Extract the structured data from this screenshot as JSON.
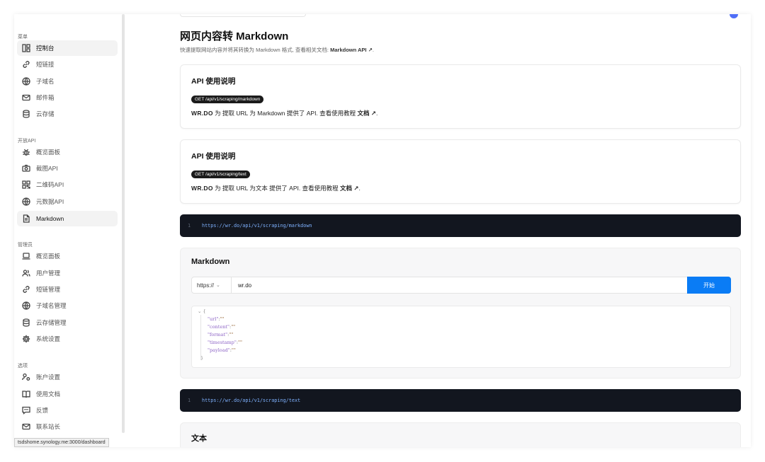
{
  "sidebar": {
    "sections": [
      {
        "title": "菜单",
        "items": [
          {
            "label": "控制台",
            "icon": "dashboard-icon",
            "active": true
          },
          {
            "label": "短链接",
            "icon": "link-icon"
          },
          {
            "label": "子域名",
            "icon": "globe-icon"
          },
          {
            "label": "邮件箱",
            "icon": "mail-icon"
          },
          {
            "label": "云存储",
            "icon": "database-icon"
          }
        ]
      },
      {
        "title": "开放API",
        "items": [
          {
            "label": "概览面板",
            "icon": "bug-icon"
          },
          {
            "label": "截图API",
            "icon": "camera-icon"
          },
          {
            "label": "二维码API",
            "icon": "qrcode-icon"
          },
          {
            "label": "元数据API",
            "icon": "globe-icon"
          },
          {
            "label": "Markdown",
            "icon": "file-text-icon",
            "active": true
          }
        ]
      },
      {
        "title": "管理员",
        "items": [
          {
            "label": "概览面板",
            "icon": "laptop-icon"
          },
          {
            "label": "用户管理",
            "icon": "users-icon"
          },
          {
            "label": "短链管理",
            "icon": "link-icon"
          },
          {
            "label": "子域名管理",
            "icon": "globe-icon"
          },
          {
            "label": "云存储管理",
            "icon": "database-icon"
          },
          {
            "label": "系统设置",
            "icon": "gear-icon"
          }
        ]
      },
      {
        "title": "选项",
        "items": [
          {
            "label": "账户设置",
            "icon": "user-cog-icon"
          },
          {
            "label": "使用文档",
            "icon": "book-icon"
          },
          {
            "label": "反馈",
            "icon": "message-icon"
          },
          {
            "label": "联系站长",
            "icon": "mail-icon"
          }
        ]
      }
    ]
  },
  "status_url": "tsdshome.synology.me:3000/dashboard",
  "page": {
    "title": "网页内容转 Markdown",
    "subtitle_prefix": "快速提取网站内容并将其转换为 Markdown 格式, 查看相关文档:",
    "subtitle_link": "Markdown API ↗",
    "subtitle_suffix": "."
  },
  "cards": [
    {
      "title": "API 使用说明",
      "endpoint": "GET /api/v1/scraping/markdown",
      "brand": "WR.DO",
      "line_prefix": "为 提取 URL 为 Markdown 提供了 API. 查看使用教程",
      "link": "文档 ↗",
      "line_suffix": "."
    },
    {
      "title": "API 使用说明",
      "endpoint": "GET /api/v1/scraping/text",
      "brand": "WR.DO",
      "line_prefix": "为 提取 URL 为文本 提供了 API. 查看使用教程",
      "link": "文档 ↗",
      "line_suffix": "."
    }
  ],
  "code_blocks": [
    {
      "line_no": "1",
      "url": "https://wr.do/api/v1/scraping/markdown"
    },
    {
      "line_no": "1",
      "url": "https://wr.do/api/v1/scraping/text"
    }
  ],
  "markdown_panel": {
    "title": "Markdown",
    "protocol": "https://",
    "domain": "wr.do",
    "start_label": "开始",
    "json_open": "⌄ {",
    "json_close": "}",
    "json_keys": [
      "\"url\"",
      "\"content\"",
      "\"format\"",
      "\"timestamp\"",
      "\"payload\""
    ],
    "json_value": "\"\""
  },
  "text_panel": {
    "title": "文本"
  },
  "colors": {
    "accent": "#0a7cf5",
    "code_bg": "#12161f",
    "code_url": "#7fb2ff"
  }
}
